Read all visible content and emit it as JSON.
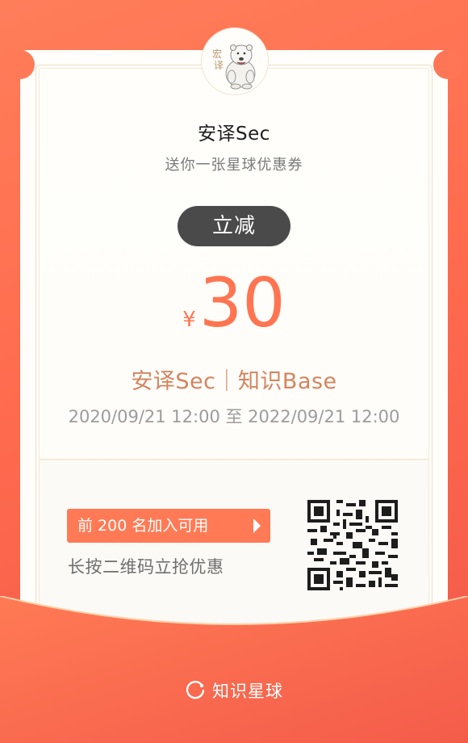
{
  "coupon": {
    "title": "安译Sec",
    "subtitle": "送你一张星球优惠券",
    "badge": "立减",
    "currency": "¥",
    "amount": "30",
    "group_name": "安译Sec｜知识Base",
    "period": "2020/09/21 12:00 至 2022/09/21 12:00",
    "cta_label": "前 200 名加入可用",
    "hint": "长按二维码立抢优惠"
  },
  "footer": {
    "brand": "知识星球"
  },
  "colors": {
    "accent": "#ff7551",
    "badge_bg": "#4a4a4a",
    "group_name": "#d5845e",
    "background": "#ff6b4e"
  },
  "icons": {
    "avatar": "polar-bear-icon",
    "cta": "play-arrow-icon",
    "brand": "planet-ring-icon",
    "qr": "qr-code-icon"
  }
}
